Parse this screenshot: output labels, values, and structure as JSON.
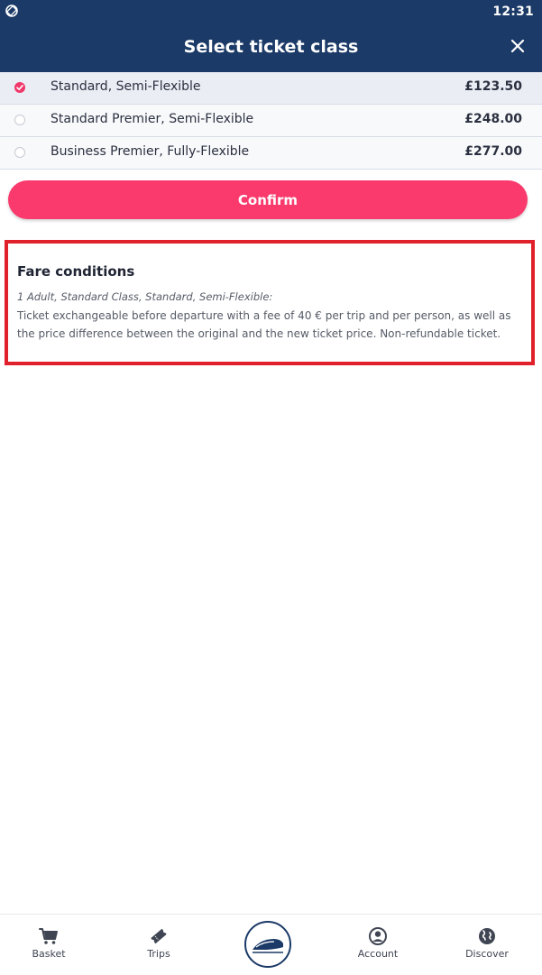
{
  "status_bar": {
    "time": "12:31"
  },
  "header": {
    "title": "Select ticket class"
  },
  "options": [
    {
      "label": "Standard, Semi-Flexible",
      "price": "£123.50",
      "selected": true
    },
    {
      "label": "Standard Premier, Semi-Flexible",
      "price": "£248.00",
      "selected": false
    },
    {
      "label": "Business Premier, Fully-Flexible",
      "price": "£277.00",
      "selected": false
    }
  ],
  "confirm_label": "Confirm",
  "fare_conditions": {
    "title": "Fare conditions",
    "subtitle": "1 Adult, Standard Class, Standard, Semi-Flexible:",
    "body": "Ticket exchangeable before departure with a fee of 40 € per trip and per person, as well as the price difference between the original and the new ticket price. Non-refundable ticket."
  },
  "nav": {
    "basket": "Basket",
    "trips": "Trips",
    "account": "Account",
    "discover": "Discover"
  },
  "colors": {
    "header_bg": "#1b3a67",
    "accent": "#fa3a6d",
    "highlight_border": "#e0202b"
  },
  "icons": {
    "status_left": "rotation-lock-icon",
    "close": "close-icon",
    "selected_radio": "check-circle-icon",
    "basket": "cart-icon",
    "trips": "ticket-icon",
    "home": "train-logo-icon",
    "account": "user-circle-icon",
    "discover": "globe-icon"
  }
}
